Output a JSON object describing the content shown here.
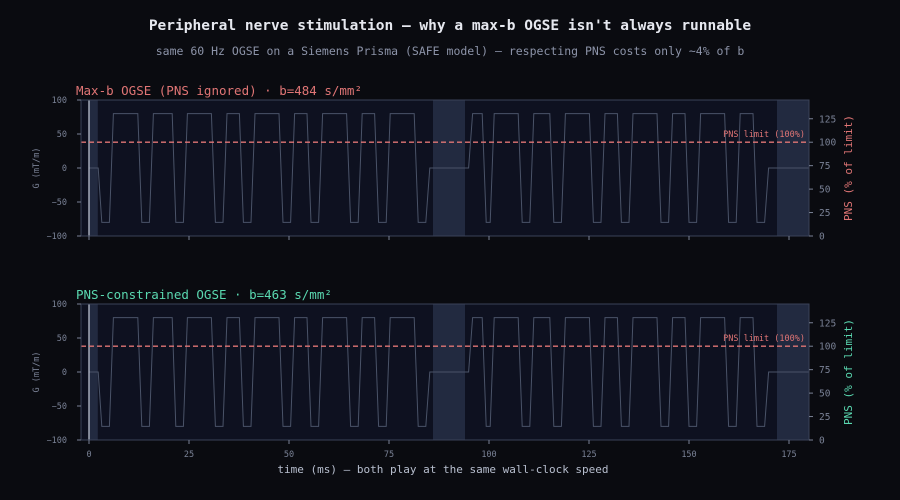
{
  "title": "Peripheral nerve stimulation — why a max-b OGSE isn't always runnable",
  "subtitle": "same 60 Hz OGSE on a Siemens Prisma (SAFE model) — respecting PNS costs only ~4% of b",
  "xlabel": "time  (ms)  —  both play at the same wall-clock speed",
  "colors": {
    "background": "#0a0b10",
    "plot_bg": "#0e1120",
    "shaded_block": "#222a40",
    "waveform": "#4a5368",
    "pns_limit": "#e07575",
    "maxb_accent": "#e07575",
    "constrained_accent": "#5ad8b0",
    "title": "#e6e8ef",
    "subtitle": "#8c93a8",
    "tick": "#7a8296"
  },
  "chart_data": [
    {
      "type": "line",
      "title": "Max-b OGSE  (PNS ignored)   ·   b=484 s/mm²",
      "ylabel": "G (mT/m)",
      "y2label": "PNS  (% of limit)",
      "xlim": [
        -2,
        180
      ],
      "ylim": [
        -100,
        100
      ],
      "y2lim": [
        0,
        145
      ],
      "xticks": [
        0,
        25,
        50,
        75,
        100,
        125,
        150,
        175
      ],
      "xticklabels": [],
      "yticks": [
        -100,
        -50,
        0,
        50,
        100
      ],
      "y2ticks": [
        0,
        25,
        50,
        75,
        100,
        125
      ],
      "pns_limit": {
        "value": 100,
        "label": "PNS limit (100%)"
      },
      "shaded_spans": [
        [
          0,
          2.2
        ],
        [
          86,
          94
        ],
        [
          172,
          180
        ]
      ],
      "x": [
        0,
        2.3,
        3.2,
        5.1,
        6.1,
        12.2,
        13.2,
        15.1,
        16.1,
        20.8,
        21.7,
        23.6,
        24.6,
        30.6,
        31.6,
        33.5,
        34.5,
        37.6,
        38.6,
        40.5,
        41.5,
        47.5,
        48.5,
        50.4,
        51.4,
        54.5,
        55.5,
        57.4,
        58.4,
        64.4,
        65.4,
        67.3,
        68.3,
        71.4,
        72.4,
        74.3,
        75.3,
        81.3,
        82.3,
        84.2,
        85.2,
        86,
        94,
        94.9,
        95.9,
        98.3,
        99.3,
        100.3,
        101.3,
        107.3,
        108.3,
        110.2,
        111.2,
        115.2,
        116.2,
        118.1,
        119.1,
        125.1,
        126.1,
        128,
        129,
        132.1,
        133.1,
        135,
        136,
        142,
        143,
        144.9,
        145.9,
        149,
        150,
        151.9,
        152.9,
        158.9,
        159.9,
        161.8,
        162.8,
        166,
        167,
        168.9,
        169.9,
        172,
        180
      ],
      "y": [
        0,
        0,
        -80,
        -80,
        80,
        80,
        -80,
        -80,
        80,
        80,
        -80,
        -80,
        80,
        80,
        -80,
        -80,
        80,
        80,
        -80,
        -80,
        80,
        80,
        -80,
        -80,
        80,
        80,
        -80,
        -80,
        80,
        80,
        -80,
        -80,
        80,
        80,
        -80,
        -80,
        80,
        80,
        -80,
        -80,
        0,
        0,
        0,
        0,
        80,
        80,
        -80,
        -80,
        80,
        80,
        -80,
        -80,
        80,
        80,
        -80,
        -80,
        80,
        80,
        -80,
        -80,
        80,
        80,
        -80,
        -80,
        80,
        80,
        -80,
        -80,
        80,
        80,
        -80,
        -80,
        80,
        80,
        -80,
        -80,
        80,
        80,
        -80,
        -80,
        0,
        0,
        0
      ]
    },
    {
      "type": "line",
      "title": "PNS-constrained OGSE   ·   b=463 s/mm²",
      "ylabel": "G (mT/m)",
      "y2label": "PNS  (% of limit)",
      "xlabel": "time  (ms)  —  both play at the same wall-clock speed",
      "xlim": [
        -2,
        180
      ],
      "ylim": [
        -100,
        100
      ],
      "y2lim": [
        0,
        145
      ],
      "xticks": [
        0,
        25,
        50,
        75,
        100,
        125,
        150,
        175
      ],
      "xticklabels": [
        "0",
        "25",
        "50",
        "75",
        "100",
        "125",
        "150",
        "175"
      ],
      "yticks": [
        -100,
        -50,
        0,
        50,
        100
      ],
      "y2ticks": [
        0,
        25,
        50,
        75,
        100,
        125
      ],
      "pns_limit": {
        "value": 100,
        "label": "PNS limit (100%)"
      },
      "shaded_spans": [
        [
          0,
          2.2
        ],
        [
          86,
          94
        ],
        [
          172,
          180
        ]
      ],
      "x": [
        0,
        2.3,
        3.2,
        5.1,
        6.1,
        12.2,
        13.2,
        15.1,
        16.1,
        20.8,
        21.7,
        23.6,
        24.6,
        30.6,
        31.6,
        33.5,
        34.5,
        37.6,
        38.6,
        40.5,
        41.5,
        47.5,
        48.5,
        50.4,
        51.4,
        54.5,
        55.5,
        57.4,
        58.4,
        64.4,
        65.4,
        67.3,
        68.3,
        71.4,
        72.4,
        74.3,
        75.3,
        81.3,
        82.3,
        84.2,
        85.2,
        86,
        94,
        94.9,
        95.9,
        98.3,
        99.3,
        100.3,
        101.3,
        107.3,
        108.3,
        110.2,
        111.2,
        115.2,
        116.2,
        118.1,
        119.1,
        125.1,
        126.1,
        128,
        129,
        132.1,
        133.1,
        135,
        136,
        142,
        143,
        144.9,
        145.9,
        149,
        150,
        151.9,
        152.9,
        158.9,
        159.9,
        161.8,
        162.8,
        166,
        167,
        168.9,
        169.9,
        172,
        180
      ],
      "y": [
        0,
        0,
        -80,
        -80,
        80,
        80,
        -80,
        -80,
        80,
        80,
        -80,
        -80,
        80,
        80,
        -80,
        -80,
        80,
        80,
        -80,
        -80,
        80,
        80,
        -80,
        -80,
        80,
        80,
        -80,
        -80,
        80,
        80,
        -80,
        -80,
        80,
        80,
        -80,
        -80,
        80,
        80,
        -80,
        -80,
        0,
        0,
        0,
        0,
        80,
        80,
        -80,
        -80,
        80,
        80,
        -80,
        -80,
        80,
        80,
        -80,
        -80,
        80,
        80,
        -80,
        -80,
        80,
        80,
        -80,
        -80,
        80,
        80,
        -80,
        -80,
        80,
        80,
        -80,
        -80,
        80,
        80,
        -80,
        -80,
        80,
        80,
        -80,
        -80,
        0,
        0,
        0
      ]
    }
  ]
}
